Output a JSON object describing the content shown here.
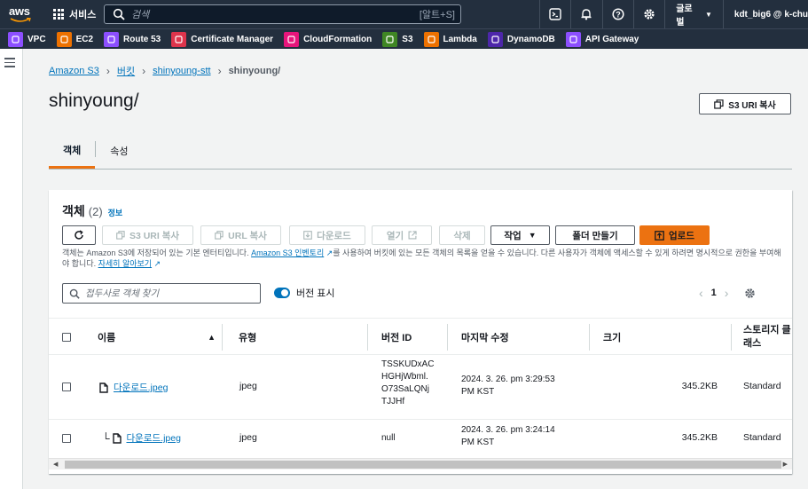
{
  "topnav": {
    "logo": "aws",
    "services_label": "서비스",
    "search_placeholder": "검색",
    "search_shortcut": "[알트+S]",
    "region": "글로벌",
    "user": "kdt_big6 @ k-chu"
  },
  "favorites": [
    {
      "label": "VPC",
      "color": "#8c4fff"
    },
    {
      "label": "EC2",
      "color": "#ed7100"
    },
    {
      "label": "Route 53",
      "color": "#8c4fff"
    },
    {
      "label": "Certificate Manager",
      "color": "#dd344c"
    },
    {
      "label": "CloudFormation",
      "color": "#e7157b"
    },
    {
      "label": "S3",
      "color": "#3f8624"
    },
    {
      "label": "Lambda",
      "color": "#ed7100"
    },
    {
      "label": "DynamoDB",
      "color": "#4d27aa"
    },
    {
      "label": "API Gateway",
      "color": "#8c4fff"
    }
  ],
  "breadcrumb": {
    "items": [
      "Amazon S3",
      "버킷",
      "shinyoung-stt"
    ],
    "current": "shinyoung/"
  },
  "page": {
    "title": "shinyoung/",
    "copy_uri_label": "S3 URI 복사"
  },
  "tabs": [
    {
      "label": "객체",
      "active": true
    },
    {
      "label": "속성",
      "active": false
    }
  ],
  "objects_panel": {
    "heading": "객체",
    "count": "(2)",
    "info_label": "정보",
    "buttons": {
      "copy_s3_uri": "S3 URI 복사",
      "copy_url": "URL 복사",
      "download": "다운로드",
      "open": "열기",
      "delete": "삭제",
      "actions": "작업",
      "create_folder": "폴더 만들기",
      "upload": "업로드"
    },
    "description": {
      "part1": "객체는 Amazon S3에 저장되어 있는 기본 엔터티입니다. ",
      "link1": "Amazon S3 인벤토리",
      "part2": "를 사용하여 버킷에 있는 모든 객체의 목록을 얻을 수 있습니다. 다른 사용자가 객체에 액세스할 수 있게 하려면 명시적으로 권한을 부여해야 합니다. ",
      "link2": "자세히 알아보기"
    },
    "filter_placeholder": "접두사로 객체 찾기",
    "show_versions_label": "버전 표시",
    "show_versions_on": true,
    "page_number": "1"
  },
  "table": {
    "columns": [
      "이름",
      "유형",
      "버전 ID",
      "마지막 수정",
      "크기",
      "스토리지 클래스"
    ],
    "rows": [
      {
        "name": "다운로드.jpeg",
        "type": "jpeg",
        "version_lines": [
          "TSSKUDxAC",
          "HGHjWbml.",
          "O73SaLQNj",
          "TJJHf"
        ],
        "modified_lines": [
          "2024. 3. 26. pm 3:29:53",
          "PM KST"
        ],
        "size": "345.2KB",
        "storage": "Standard"
      },
      {
        "name": "다운로드.jpeg",
        "type": "jpeg",
        "version_lines": [
          "null"
        ],
        "modified_lines": [
          "2024. 3. 26. pm 3:24:14",
          "PM KST"
        ],
        "size": "345.2KB",
        "storage": "Standard"
      }
    ]
  }
}
